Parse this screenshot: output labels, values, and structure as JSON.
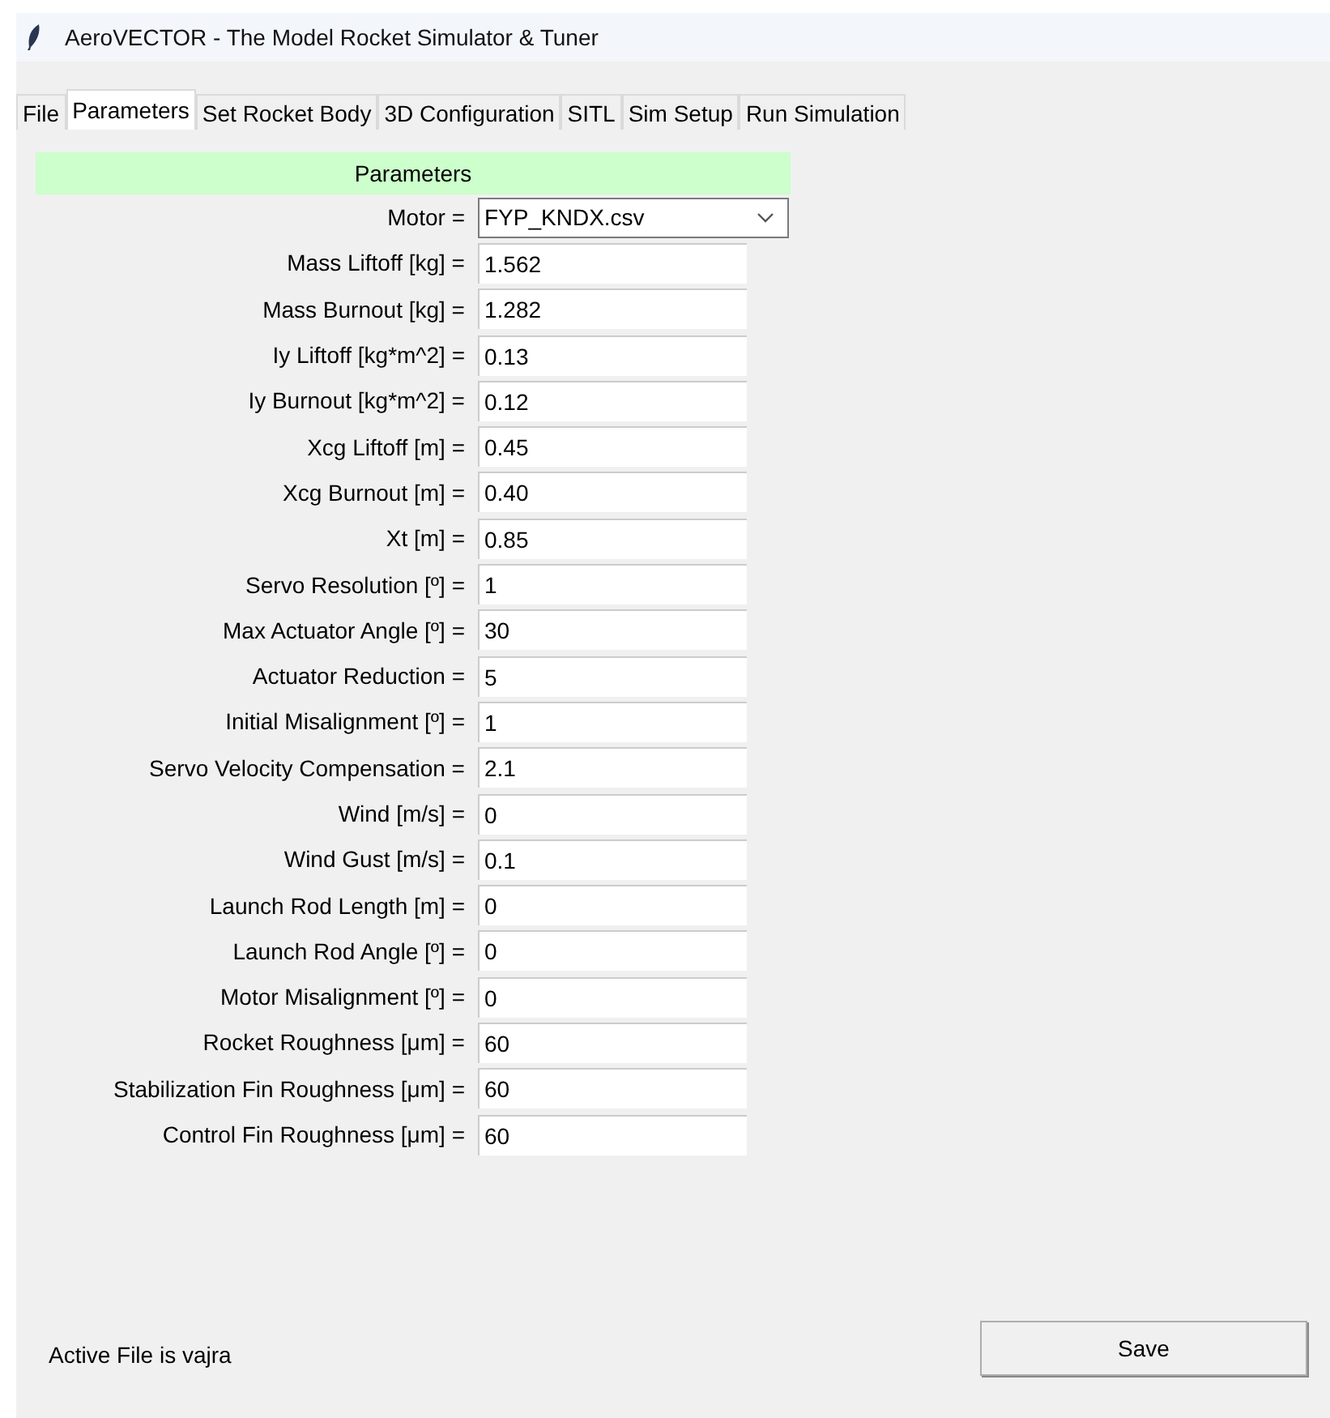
{
  "window": {
    "title": "AeroVECTOR - The Model Rocket Simulator & Tuner"
  },
  "tabs": [
    {
      "label": "File",
      "selected": false
    },
    {
      "label": "Parameters",
      "selected": true
    },
    {
      "label": "Set Rocket Body",
      "selected": false
    },
    {
      "label": "3D Configuration",
      "selected": false
    },
    {
      "label": "SITL",
      "selected": false
    },
    {
      "label": "Sim Setup",
      "selected": false
    },
    {
      "label": "Run Simulation",
      "selected": false
    }
  ],
  "section_header": "Parameters",
  "fields": [
    {
      "kind": "dropdown",
      "label": "Motor =",
      "value": "FYP_KNDX.csv"
    },
    {
      "kind": "entry",
      "label": "Mass Liftoff [kg] =",
      "value": "1.562"
    },
    {
      "kind": "entry",
      "label": "Mass Burnout [kg] =",
      "value": "1.282"
    },
    {
      "kind": "entry",
      "label": "Iy Liftoff [kg*m^2] =",
      "value": "0.13"
    },
    {
      "kind": "entry",
      "label": "Iy Burnout [kg*m^2] =",
      "value": "0.12"
    },
    {
      "kind": "entry",
      "label": "Xcg Liftoff [m] =",
      "value": "0.45"
    },
    {
      "kind": "entry",
      "label": "Xcg Burnout [m] =",
      "value": "0.40"
    },
    {
      "kind": "entry",
      "label": "Xt [m] =",
      "value": "0.85"
    },
    {
      "kind": "entry",
      "label": "Servo Resolution [º] =",
      "value": "1"
    },
    {
      "kind": "entry",
      "label": "Max Actuator Angle [º] =",
      "value": "30"
    },
    {
      "kind": "entry",
      "label": "Actuator Reduction =",
      "value": "5"
    },
    {
      "kind": "entry",
      "label": "Initial Misalignment [º] =",
      "value": "1"
    },
    {
      "kind": "entry",
      "label": "Servo Velocity Compensation =",
      "value": "2.1"
    },
    {
      "kind": "entry",
      "label": "Wind [m/s] =",
      "value": "0"
    },
    {
      "kind": "entry",
      "label": "Wind Gust [m/s] =",
      "value": "0.1"
    },
    {
      "kind": "entry",
      "label": "Launch Rod Length [m] =",
      "value": "0"
    },
    {
      "kind": "entry",
      "label": "Launch Rod Angle [º] =",
      "value": "0"
    },
    {
      "kind": "entry",
      "label": "Motor Misalignment [º] =",
      "value": "0"
    },
    {
      "kind": "entry",
      "label": "Rocket Roughness [μm] =",
      "value": "60"
    },
    {
      "kind": "entry",
      "label": "Stabilization Fin Roughness [μm] =",
      "value": "60"
    },
    {
      "kind": "entry",
      "label": "Control Fin Roughness [μm] =",
      "value": "60"
    }
  ],
  "status": "Active File is vajra",
  "save_button": "Save"
}
